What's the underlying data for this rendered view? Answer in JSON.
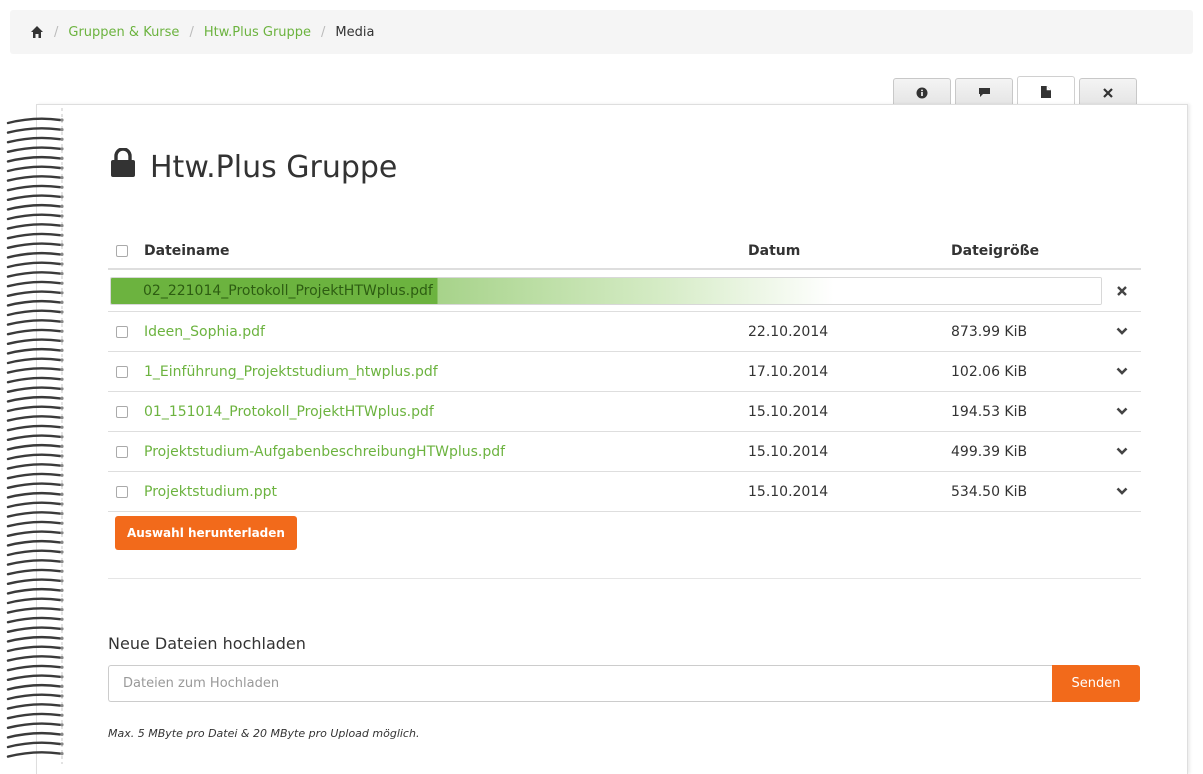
{
  "breadcrumb": {
    "home_icon": "home-icon",
    "items": [
      "Gruppen & Kurse",
      "Htw.Plus Gruppe"
    ],
    "current": "Media",
    "separator": "/"
  },
  "tabs": [
    {
      "icon": "info-icon"
    },
    {
      "icon": "comment-icon"
    },
    {
      "icon": "file-icon",
      "active": true
    },
    {
      "icon": "close-icon"
    }
  ],
  "page": {
    "title": "Htw.Plus Gruppe",
    "title_icon": "lock-icon"
  },
  "table": {
    "headers": {
      "name": "Dateiname",
      "date": "Datum",
      "size": "Dateigröße"
    },
    "uploading": {
      "name": "02_221014_Protokoll_ProjektHTWplus.pdf",
      "progress": 0.33
    },
    "rows": [
      {
        "name": "Ideen_Sophia.pdf",
        "date": "22.10.2014",
        "size": "873.99 KiB"
      },
      {
        "name": "1_Einführung_Projektstudium_htwplus.pdf",
        "date": "17.10.2014",
        "size": "102.06 KiB"
      },
      {
        "name": "01_151014_Protokoll_ProjektHTWplus.pdf",
        "date": "15.10.2014",
        "size": "194.53 KiB"
      },
      {
        "name": "Projektstudium-AufgabenbeschreibungHTWplus.pdf",
        "date": "15.10.2014",
        "size": "499.39 KiB"
      },
      {
        "name": "Projektstudium.ppt",
        "date": "15.10.2014",
        "size": "534.50 KiB"
      }
    ]
  },
  "actions": {
    "download_selected": "Auswahl herunterladen"
  },
  "upload": {
    "title": "Neue Dateien hochladen",
    "placeholder": "Dateien zum Hochladen",
    "send": "Senden",
    "note": "Max. 5 MByte pro Datei & 20 MByte pro Upload möglich."
  },
  "colors": {
    "accent": "#6cb33f",
    "button": "#f26a1b"
  }
}
